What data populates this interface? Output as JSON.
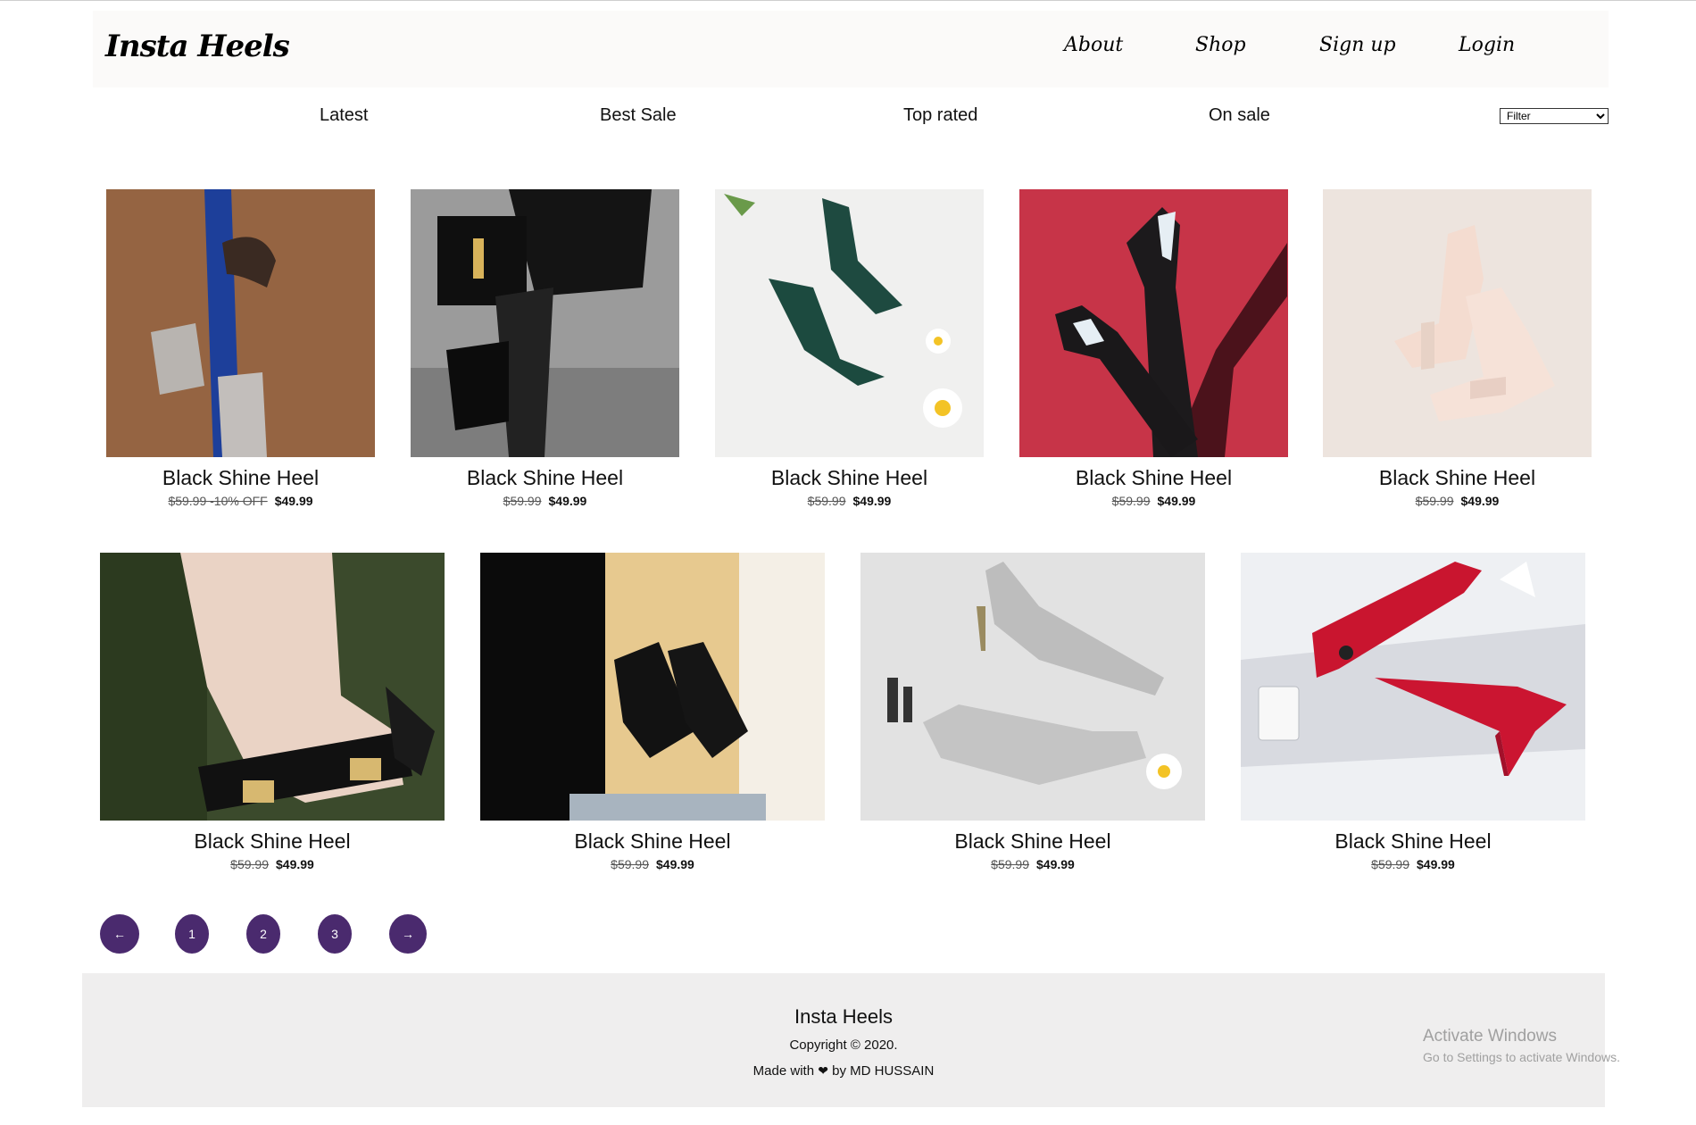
{
  "header": {
    "brand": "Insta Heels",
    "nav": [
      "About",
      "Shop",
      "Sign up",
      "Login"
    ]
  },
  "categories": [
    "Latest",
    "Best Sale",
    "Top rated",
    "On sale"
  ],
  "filter": {
    "selected": "Filter"
  },
  "products_row1": [
    {
      "title": "Black Shine Heel",
      "old_price": "$59.99 -10% OFF",
      "price": "$49.99"
    },
    {
      "title": "Black Shine Heel",
      "old_price": "$59.99",
      "price": "$49.99"
    },
    {
      "title": "Black Shine Heel",
      "old_price": "$59.99",
      "price": "$49.99"
    },
    {
      "title": "Black Shine Heel",
      "old_price": "$59.99",
      "price": "$49.99"
    },
    {
      "title": "Black Shine Heel",
      "old_price": "$59.99",
      "price": "$49.99"
    }
  ],
  "products_row2": [
    {
      "title": "Black Shine Heel",
      "old_price": "$59.99",
      "price": "$49.99"
    },
    {
      "title": "Black Shine Heel",
      "old_price": "$59.99",
      "price": "$49.99"
    },
    {
      "title": "Black Shine Heel",
      "old_price": "$59.99",
      "price": "$49.99"
    },
    {
      "title": "Black Shine Heel",
      "old_price": "$59.99",
      "price": "$49.99"
    }
  ],
  "pagination": {
    "prev_icon": "arrow-left-icon",
    "pages": [
      "1",
      "2",
      "3"
    ],
    "next_icon": "arrow-right-icon"
  },
  "footer": {
    "name": "Insta Heels",
    "copyright": "Copyright © 2020.",
    "made_prefix": "Made with",
    "made_suffix": "by MD HUSSAIN"
  },
  "watermark": {
    "line1": "Activate Windows",
    "line2": "Go to Settings to activate Windows."
  },
  "colors": {
    "accent": "#4a2a6e",
    "header_bg": "#fbfaf9",
    "footer_bg": "#efeeee"
  }
}
